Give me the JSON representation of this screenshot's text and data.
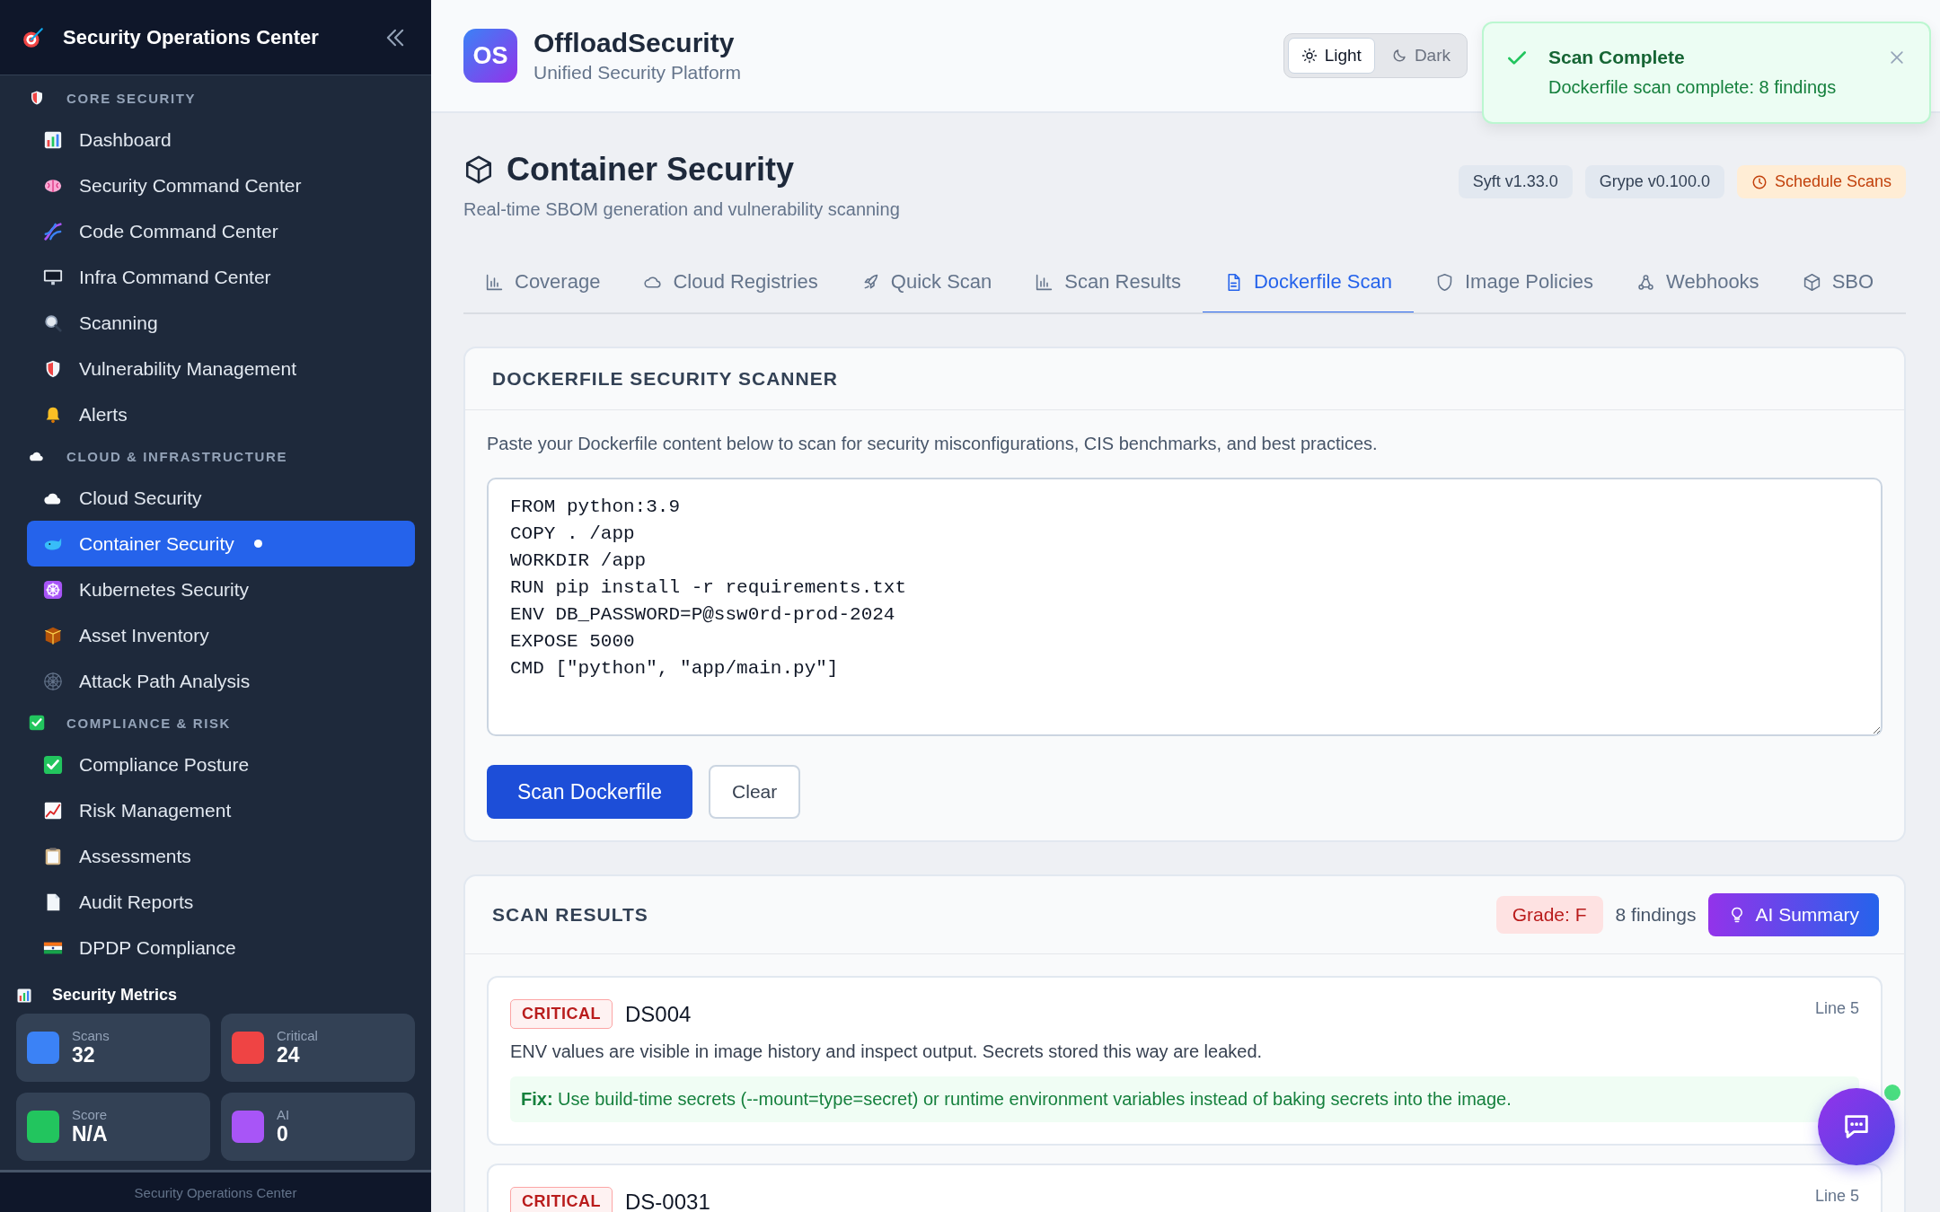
{
  "sidebar": {
    "title": "Security Operations Center",
    "sections": [
      {
        "title": "CORE SECURITY",
        "items": [
          {
            "label": "Dashboard",
            "selected": false
          },
          {
            "label": "Security Command Center",
            "selected": false
          },
          {
            "label": "Code Command Center",
            "selected": false
          },
          {
            "label": "Infra Command Center",
            "selected": false
          },
          {
            "label": "Scanning",
            "selected": false
          },
          {
            "label": "Vulnerability Management",
            "selected": false
          },
          {
            "label": "Alerts",
            "selected": false
          }
        ]
      },
      {
        "title": "CLOUD & INFRASTRUCTURE",
        "items": [
          {
            "label": "Cloud Security",
            "selected": false
          },
          {
            "label": "Container Security",
            "selected": true
          },
          {
            "label": "Kubernetes Security",
            "selected": false
          },
          {
            "label": "Asset Inventory",
            "selected": false
          },
          {
            "label": "Attack Path Analysis",
            "selected": false
          }
        ]
      },
      {
        "title": "COMPLIANCE & RISK",
        "items": [
          {
            "label": "Compliance Posture",
            "selected": false
          },
          {
            "label": "Risk Management",
            "selected": false
          },
          {
            "label": "Assessments",
            "selected": false
          },
          {
            "label": "Audit Reports",
            "selected": false
          },
          {
            "label": "DPDP Compliance",
            "selected": false
          }
        ]
      }
    ],
    "metrics": {
      "title": "Security Metrics",
      "cards": [
        {
          "label": "Scans",
          "value": "32",
          "color": "#3b82f6"
        },
        {
          "label": "Critical",
          "value": "24",
          "color": "#ef4444"
        },
        {
          "label": "Score",
          "value": "N/A",
          "color": "#22c55e"
        },
        {
          "label": "AI",
          "value": "0",
          "color": "#a855f7"
        }
      ]
    },
    "footer": "Security Operations Center"
  },
  "header": {
    "logo": "OS",
    "brand": "OffloadSecurity",
    "tagline": "Unified Security Platform",
    "theme_options": [
      {
        "label": "Light",
        "selected": true
      },
      {
        "label": "Dark",
        "selected": false
      }
    ]
  },
  "toast": {
    "title": "Scan Complete",
    "message": "Dockerfile scan complete: 8 findings"
  },
  "page": {
    "title": "Container Security",
    "subtitle": "Real-time SBOM generation and vulnerability scanning",
    "badges": [
      {
        "label": "Syft v1.33.0",
        "kind": "version"
      },
      {
        "label": "Grype v0.100.0",
        "kind": "version"
      },
      {
        "label": "Schedule Scans",
        "kind": "action"
      }
    ]
  },
  "tabs": [
    {
      "label": "Coverage",
      "selected": false
    },
    {
      "label": "Cloud Registries",
      "selected": false
    },
    {
      "label": "Quick Scan",
      "selected": false
    },
    {
      "label": "Scan Results",
      "selected": false
    },
    {
      "label": "Dockerfile Scan",
      "selected": true
    },
    {
      "label": "Image Policies",
      "selected": false
    },
    {
      "label": "Webhooks",
      "selected": false
    },
    {
      "label": "SBO",
      "selected": false
    }
  ],
  "scanner": {
    "title": "DOCKERFILE SECURITY SCANNER",
    "description": "Paste your Dockerfile content below to scan for security misconfigurations, CIS benchmarks, and best practices.",
    "dockerfile": "FROM python:3.9\nCOPY . /app\nWORKDIR /app\nRUN pip install -r requirements.txt\nENV DB_PASSWORD=P@ssw0rd-prod-2024\nEXPOSE 5000\nCMD [\"python\", \"app/main.py\"]",
    "buttons": [
      {
        "label": "Scan Dockerfile",
        "kind": "primary"
      },
      {
        "label": "Clear",
        "kind": "secondary"
      }
    ]
  },
  "results": {
    "title": "SCAN RESULTS",
    "grade": "Grade: F",
    "count": "8 findings",
    "ai_button": "AI Summary",
    "findings": [
      {
        "severity": "CRITICAL",
        "rule": "DS004",
        "line": "Line 5",
        "description": "ENV values are visible in image history and inspect output. Secrets stored this way are leaked.",
        "fix": "**Fix:** Use build-time secrets (--mount=type=secret) or runtime environment variables instead of baking secrets into the image."
      },
      {
        "severity": "CRITICAL",
        "rule": "DS-0031",
        "line": "Line 5"
      }
    ]
  }
}
